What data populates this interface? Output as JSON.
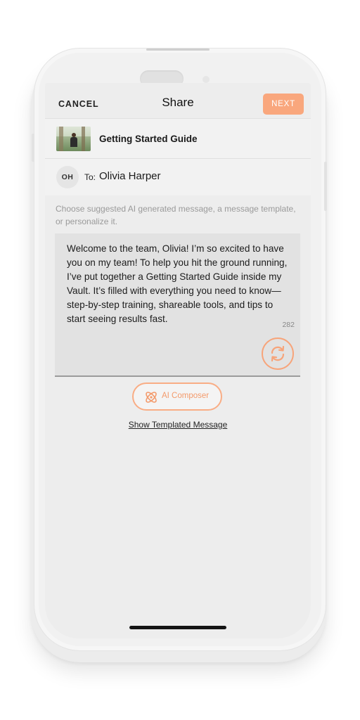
{
  "header": {
    "cancel_label": "CANCEL",
    "title": "Share",
    "next_label": "NEXT"
  },
  "guide": {
    "title": "Getting Started Guide"
  },
  "recipient": {
    "initials": "OH",
    "to_label": "To:",
    "name": "Olivia Harper"
  },
  "hint": "Choose suggested AI generated message, a message template, or personalize it.",
  "message": {
    "text": "Welcome to the team, Olivia! I’m so excited to have you on my team! To help you hit the ground running, I’ve put together a Getting Started Guide inside my Vault. It’s filled with everything you need to know—step-by-step training, shareable tools, and tips to start seeing results fast.",
    "char_count": "282"
  },
  "actions": {
    "ai_composer_label": "AI Composer",
    "show_template_label": "Show Templated Message"
  },
  "colors": {
    "accent": "#f9a77d",
    "accent_text": "#f39a6b",
    "background": "#ededed"
  },
  "icons": {
    "refresh": "refresh-icon",
    "ai": "atom-icon"
  }
}
